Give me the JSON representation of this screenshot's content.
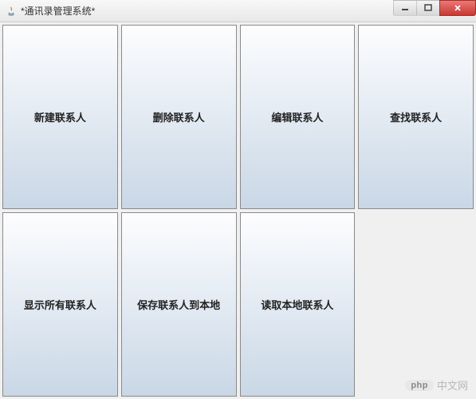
{
  "window": {
    "title": "*通讯录管理系统*"
  },
  "buttons": [
    {
      "label": "新建联系人"
    },
    {
      "label": "删除联系人"
    },
    {
      "label": "编辑联系人"
    },
    {
      "label": "查找联系人"
    },
    {
      "label": "显示所有联系人"
    },
    {
      "label": "保存联系人到本地"
    },
    {
      "label": "读取本地联系人"
    }
  ],
  "watermark": {
    "badge": "php",
    "text": "中文网"
  }
}
